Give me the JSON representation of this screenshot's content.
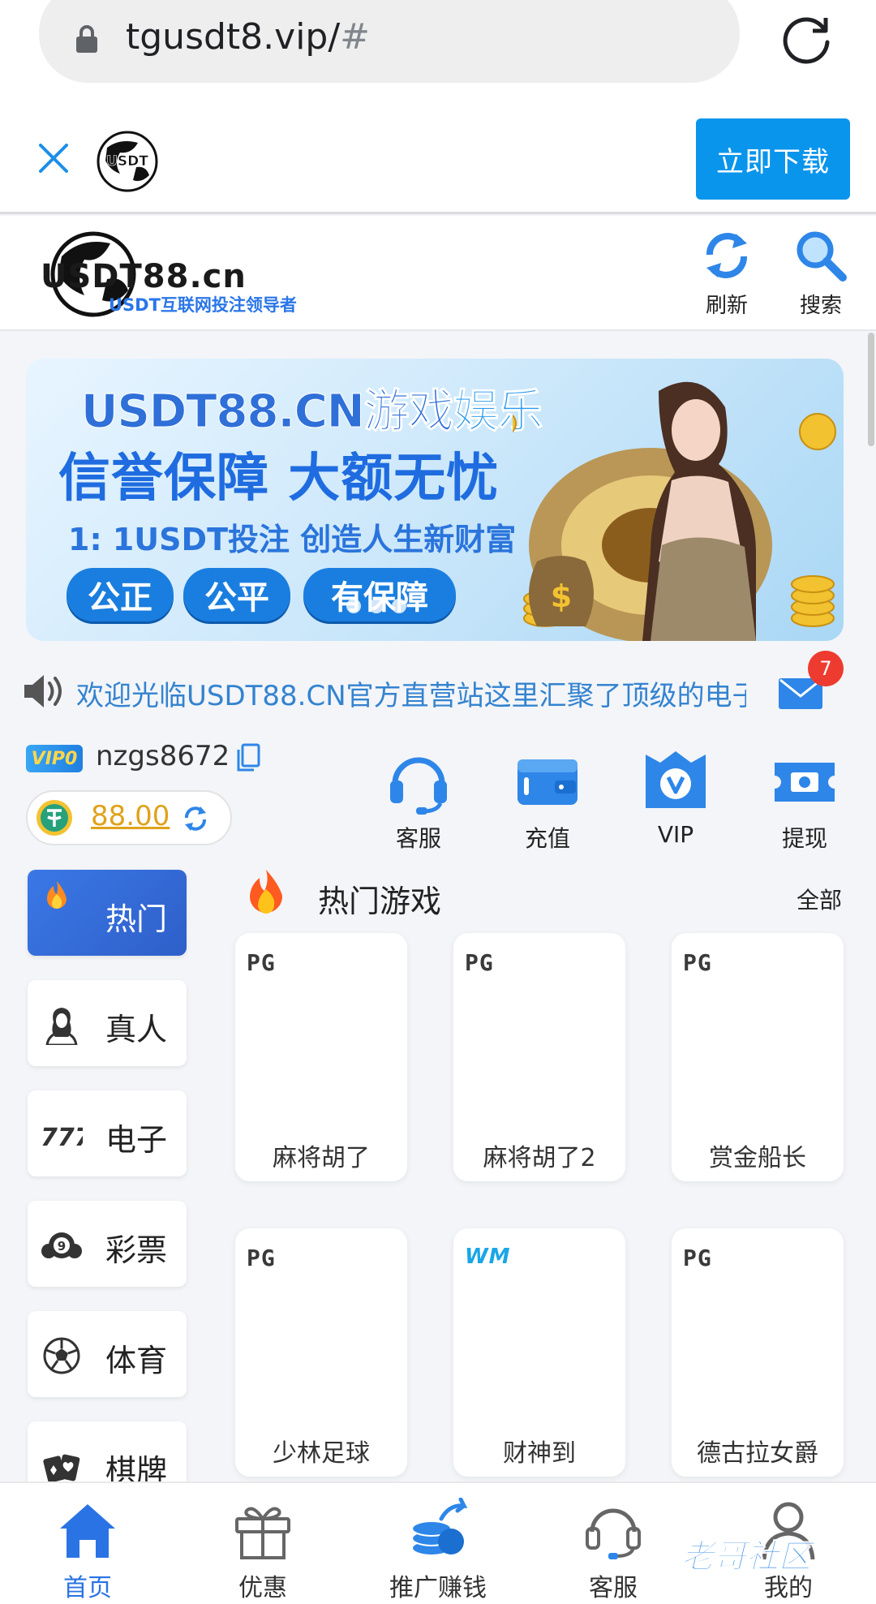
{
  "browser": {
    "url_host": "tgusdt8.vip/",
    "url_hash": "#"
  },
  "app_banner": {
    "logo_text": "USDT",
    "download_label": "立即下载"
  },
  "header": {
    "logo_title": "USDT88.cn",
    "logo_subtitle": "USDT互联网投注领导者",
    "refresh_label": "刷新",
    "search_label": "搜索"
  },
  "hero": {
    "line1_a": "USDT88.CN游戏",
    "line1_b": "娱乐",
    "line2": "信誉保障 大额无忧",
    "line3": "1: 1USDT投注 创造人生新财富",
    "chips": [
      "公正",
      "公平",
      "有保障"
    ]
  },
  "notice": {
    "text": "欢迎光临USDT88.CN官方直营站这里汇聚了顶级的电子",
    "unread_count": "7"
  },
  "user": {
    "vip_level": "VIP0",
    "username": "nzgs8672",
    "balance": "88.00"
  },
  "quick_actions": [
    {
      "label": "客服",
      "icon": "headset-icon"
    },
    {
      "label": "充值",
      "icon": "wallet-icon"
    },
    {
      "label": "VIP",
      "icon": "vip-shield-icon"
    },
    {
      "label": "提现",
      "icon": "ticket-icon"
    }
  ],
  "categories": [
    {
      "label": "热门",
      "icon": "fire-icon",
      "active": true
    },
    {
      "label": "真人",
      "icon": "dealer-icon",
      "active": false
    },
    {
      "label": "电子",
      "icon": "slot-777-icon",
      "active": false
    },
    {
      "label": "彩票",
      "icon": "lottery-ball-icon",
      "active": false
    },
    {
      "label": "体育",
      "icon": "soccer-ball-icon",
      "active": false
    },
    {
      "label": "棋牌",
      "icon": "playing-cards-icon",
      "active": false
    }
  ],
  "games_section": {
    "title": "热门游戏",
    "all_label": "全部",
    "games": [
      {
        "provider": "PG",
        "name": "麻将胡了"
      },
      {
        "provider": "PG",
        "name": "麻将胡了2"
      },
      {
        "provider": "PG",
        "name": "赏金船长"
      },
      {
        "provider": "PG",
        "name": "少林足球"
      },
      {
        "provider": "WM",
        "name": "财神到"
      },
      {
        "provider": "PG",
        "name": "德古拉女爵"
      }
    ]
  },
  "bottom_nav": [
    {
      "label": "首页",
      "icon": "home-icon",
      "active": true
    },
    {
      "label": "优惠",
      "icon": "gift-icon",
      "active": false
    },
    {
      "label": "推广赚钱",
      "icon": "coins-share-icon",
      "active": false
    },
    {
      "label": "客服",
      "icon": "headset-icon",
      "active": false
    },
    {
      "label": "我的",
      "icon": "user-icon",
      "active": false
    }
  ],
  "watermark": "老哥社区",
  "colors": {
    "accent": "#2a73e4",
    "download_button": "#0a95ec",
    "balance": "#e0a21a",
    "badge": "#ee3b30"
  }
}
